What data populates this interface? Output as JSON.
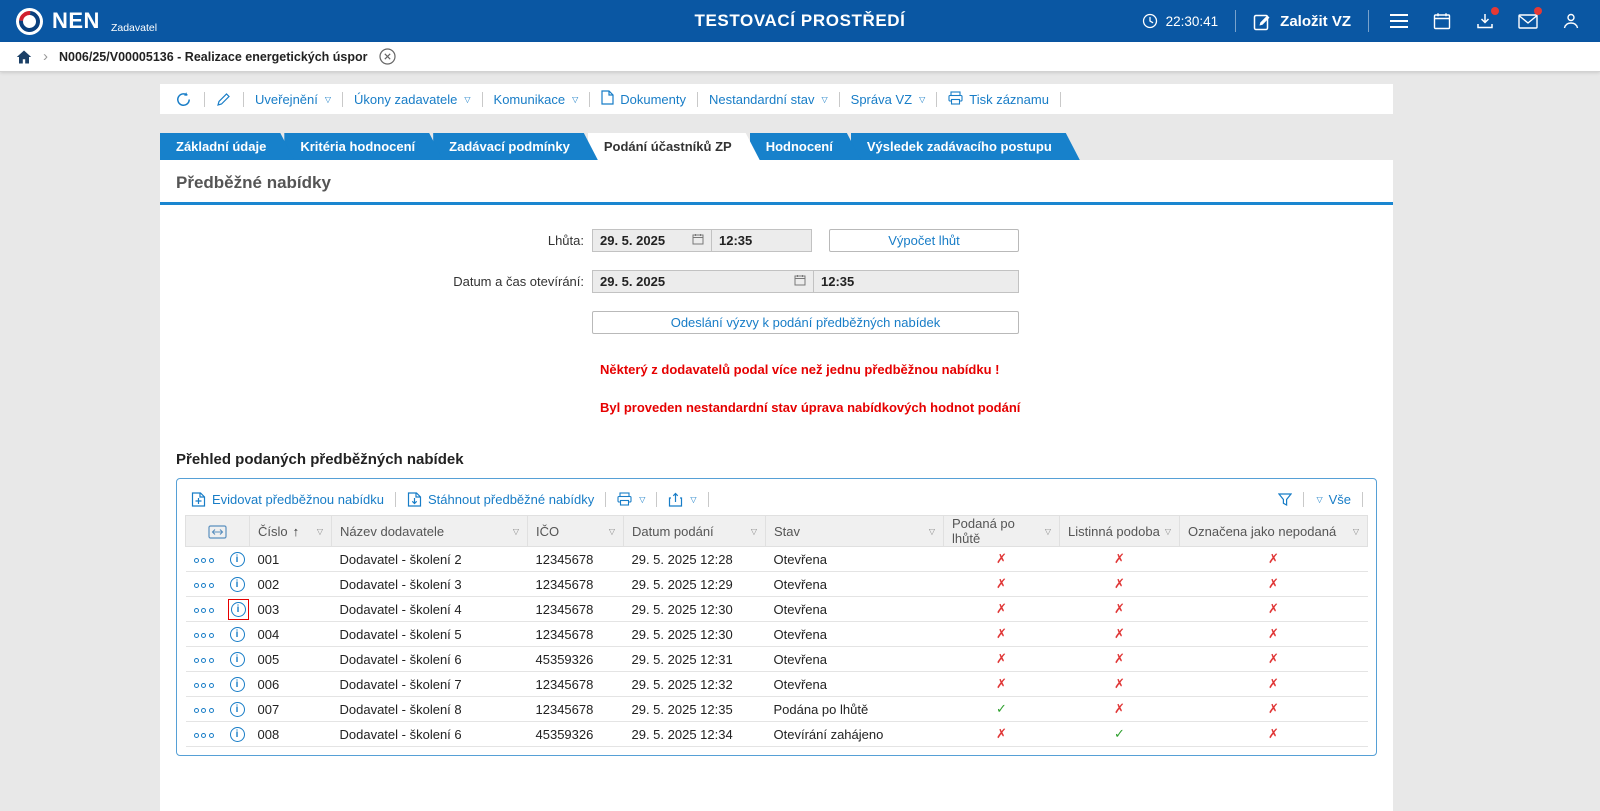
{
  "header": {
    "brand": "NEN",
    "brand_sub": "Zadavatel",
    "title": "TESTOVACÍ PROSTŘEDÍ",
    "clock": "22:30:41",
    "create_vz": "Založit VZ",
    "accent_color": "#0a57a3"
  },
  "breadcrumb": {
    "item": "N006/25/V00005136 - Realizace energetických úspor"
  },
  "record_toolbar": {
    "items": [
      {
        "label": "Uveřejnění",
        "dropdown": true
      },
      {
        "label": "Úkony zadavatele",
        "dropdown": true
      },
      {
        "label": "Komunikace",
        "dropdown": true
      },
      {
        "label": "Dokumenty",
        "icon": "document-icon"
      },
      {
        "label": "Nestandardní stav",
        "dropdown": true
      },
      {
        "label": "Správa VZ",
        "dropdown": true
      },
      {
        "label": "Tisk záznamu",
        "icon": "printer-icon"
      }
    ]
  },
  "tabs": [
    {
      "label": "Základní údaje",
      "active": false
    },
    {
      "label": "Kritéria hodnocení",
      "active": false
    },
    {
      "label": "Zadávací podmínky",
      "active": false
    },
    {
      "label": "Podání účastníků ZP",
      "active": true
    },
    {
      "label": "Hodnocení",
      "active": false
    },
    {
      "label": "Výsledek zadávacího postupu",
      "active": false
    }
  ],
  "section": {
    "title": "Předběžné nabídky"
  },
  "form": {
    "lhuta_label": "Lhůta:",
    "lhuta_date": "29. 5. 2025",
    "lhuta_time": "12:35",
    "vypocet_button": "Výpočet lhůt",
    "otevirani_label": "Datum a čas otevírání:",
    "otevirani_date": "29. 5. 2025",
    "otevirani_time": "12:35",
    "odeslani_button": "Odeslání výzvy k podání předběžných nabídek"
  },
  "warnings": [
    "Některý z dodavatelů podal více než jednu předběžnou nabídku !",
    "Byl proveden nestandardní stav úprava nabídkových hodnot podání"
  ],
  "offers": {
    "heading": "Přehled podaných předběžných nabídek",
    "toolbar": {
      "evidovat": "Evidovat předběžnou nabídku",
      "stahnout": "Stáhnout předběžné nabídky",
      "vse": "Vše"
    },
    "columns": [
      {
        "label": "Číslo",
        "sort": "asc"
      },
      {
        "label": "Název dodavatele"
      },
      {
        "label": "IČO"
      },
      {
        "label": "Datum podání"
      },
      {
        "label": "Stav"
      },
      {
        "label": "Podaná po lhůtě"
      },
      {
        "label": "Listinná podoba"
      },
      {
        "label": "Označena jako nepodaná"
      }
    ],
    "rows": [
      {
        "cislo": "001",
        "dodavatel": "Dodavatel - školení 2",
        "ico": "12345678",
        "datum": "29. 5. 2025 12:28",
        "stav": "Otevřena",
        "podana_po_lhute": false,
        "listinna_podoba": false,
        "oznacena_nepodana": false,
        "info_highlight": false
      },
      {
        "cislo": "002",
        "dodavatel": "Dodavatel - školení 3",
        "ico": "12345678",
        "datum": "29. 5. 2025 12:29",
        "stav": "Otevřena",
        "podana_po_lhute": false,
        "listinna_podoba": false,
        "oznacena_nepodana": false,
        "info_highlight": false
      },
      {
        "cislo": "003",
        "dodavatel": "Dodavatel - školení 4",
        "ico": "12345678",
        "datum": "29. 5. 2025 12:30",
        "stav": "Otevřena",
        "podana_po_lhute": false,
        "listinna_podoba": false,
        "oznacena_nepodana": false,
        "info_highlight": true
      },
      {
        "cislo": "004",
        "dodavatel": "Dodavatel - školení 5",
        "ico": "12345678",
        "datum": "29. 5. 2025 12:30",
        "stav": "Otevřena",
        "podana_po_lhute": false,
        "listinna_podoba": false,
        "oznacena_nepodana": false,
        "info_highlight": false
      },
      {
        "cislo": "005",
        "dodavatel": "Dodavatel - školení 6",
        "ico": "45359326",
        "datum": "29. 5. 2025 12:31",
        "stav": "Otevřena",
        "podana_po_lhute": false,
        "listinna_podoba": false,
        "oznacena_nepodana": false,
        "info_highlight": false
      },
      {
        "cislo": "006",
        "dodavatel": "Dodavatel - školení 7",
        "ico": "12345678",
        "datum": "29. 5. 2025 12:32",
        "stav": "Otevřena",
        "podana_po_lhute": false,
        "listinna_podoba": false,
        "oznacena_nepodana": false,
        "info_highlight": false
      },
      {
        "cislo": "007",
        "dodavatel": "Dodavatel - školení 8",
        "ico": "12345678",
        "datum": "29. 5. 2025 12:35",
        "stav": "Podána po lhůtě",
        "podana_po_lhute": true,
        "listinna_podoba": false,
        "oznacena_nepodana": false,
        "info_highlight": false
      },
      {
        "cislo": "008",
        "dodavatel": "Dodavatel - školení 6",
        "ico": "45359326",
        "datum": "29. 5. 2025 12:34",
        "stav": "Otevírání zahájeno",
        "podana_po_lhute": false,
        "listinna_podoba": true,
        "oznacena_nepodana": false,
        "info_highlight": false
      }
    ],
    "status_colors": {
      "yes": "#2fa12f",
      "no": "#e03636"
    }
  }
}
